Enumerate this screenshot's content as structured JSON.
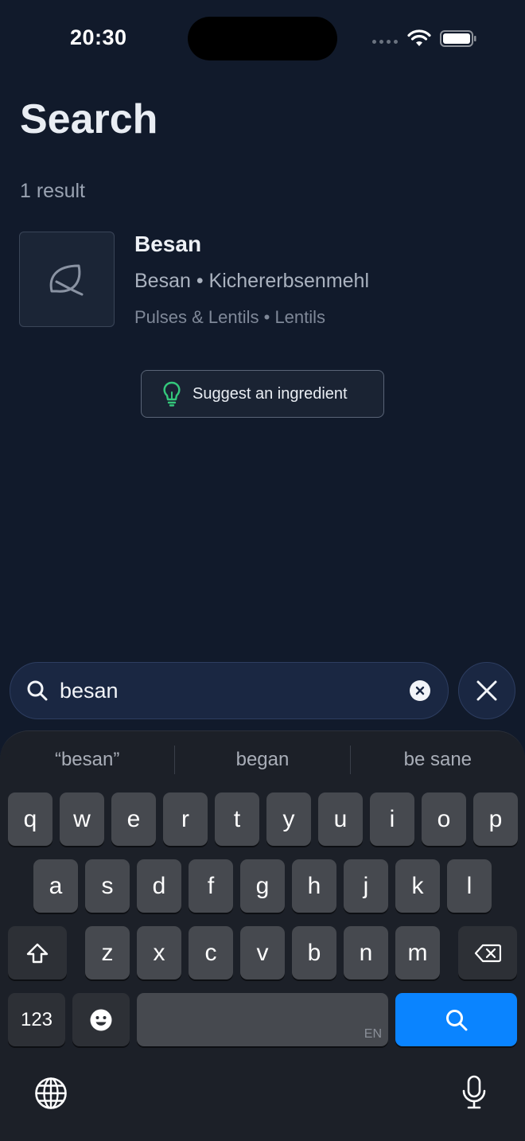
{
  "status_bar": {
    "time": "20:30"
  },
  "header": {
    "title": "Search"
  },
  "results": {
    "count_label": "1 result",
    "items": [
      {
        "name": "Besan",
        "aliases": "Besan • Kichererbsenmehl",
        "categories": "Pulses & Lentils • Lentils",
        "icon": "leaf-icon"
      }
    ]
  },
  "suggest": {
    "label": "Suggest an ingredient",
    "icon": "lightbulb-icon",
    "icon_color": "#34c77b"
  },
  "search": {
    "value": "besan"
  },
  "keyboard": {
    "predictions": [
      "“besan”",
      "began",
      "be sane"
    ],
    "row1": [
      "q",
      "w",
      "e",
      "r",
      "t",
      "y",
      "u",
      "i",
      "o",
      "p"
    ],
    "row2": [
      "a",
      "s",
      "d",
      "f",
      "g",
      "h",
      "j",
      "k",
      "l"
    ],
    "row3": [
      "z",
      "x",
      "c",
      "v",
      "b",
      "n",
      "m"
    ],
    "numbers_label": "123",
    "space_lang": "EN",
    "accent": "#0a84ff"
  }
}
